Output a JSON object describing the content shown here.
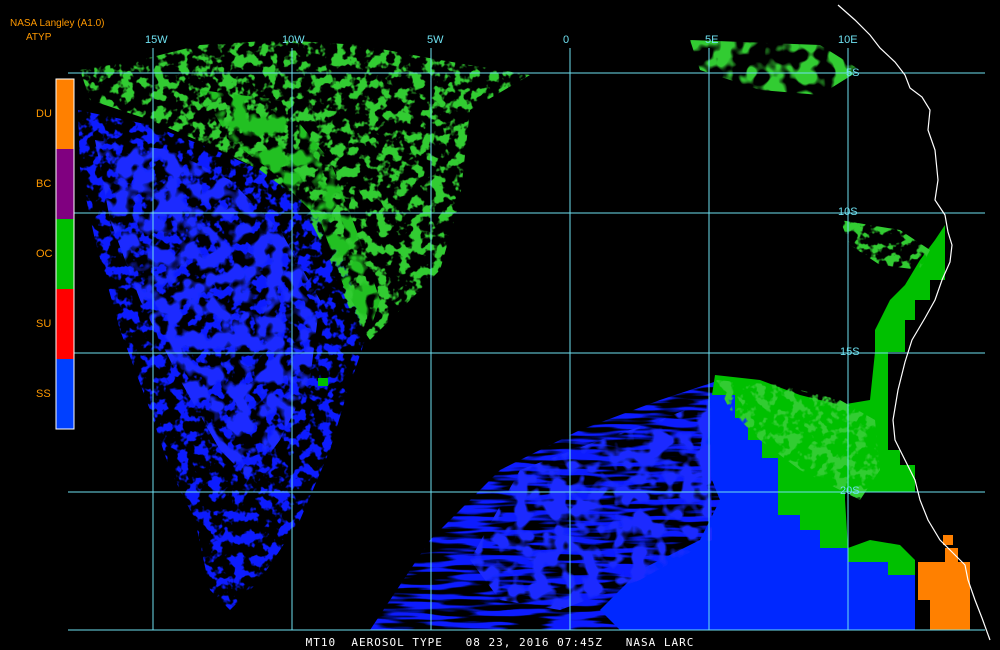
{
  "header": {
    "source": "NASA Langley (A1.0)",
    "product": "ATYP"
  },
  "legend": {
    "items": [
      {
        "label": "DU",
        "color": "#ff8000"
      },
      {
        "label": "BC",
        "color": "#800080"
      },
      {
        "label": "OC",
        "color": "#00c000"
      },
      {
        "label": "SU",
        "color": "#ff0000"
      },
      {
        "label": "SS",
        "color": "#0040ff"
      }
    ]
  },
  "grid": {
    "longitude_labels": [
      "15W",
      "10W",
      "5W",
      "0",
      "5E",
      "10E"
    ],
    "latitude_labels": [
      "5S",
      "10S",
      "15S",
      "20S"
    ],
    "color": "#6ee0f0"
  },
  "colors": {
    "dust": "#ff8000",
    "organic_carbon": "#00c000",
    "organic_carbon_light": "#33cc33",
    "sea_salt": "#0000ff",
    "coastline": "#ffffff",
    "background": "#000000"
  },
  "footer": {
    "text": "MT10  AEROSOL TYPE   08 23, 2016 07:45Z   NASA LARC"
  }
}
